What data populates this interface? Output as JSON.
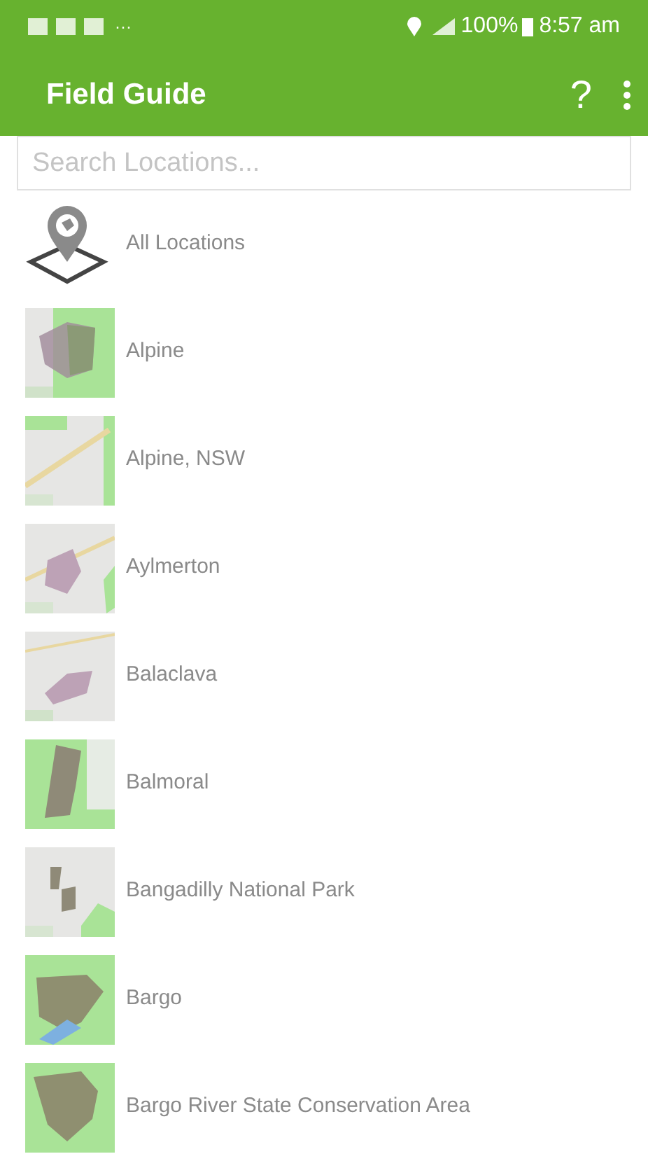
{
  "status_bar": {
    "more": "···",
    "battery": "100%",
    "time": "8:57 am"
  },
  "app_bar": {
    "title": "Field Guide",
    "help": "?"
  },
  "search": {
    "placeholder": "Search Locations..."
  },
  "locations": [
    {
      "name": "All Locations",
      "kind": "all"
    },
    {
      "name": "Alpine",
      "kind": "map"
    },
    {
      "name": "Alpine, NSW",
      "kind": "map"
    },
    {
      "name": "Aylmerton",
      "kind": "map"
    },
    {
      "name": "Balaclava",
      "kind": "map"
    },
    {
      "name": "Balmoral",
      "kind": "map"
    },
    {
      "name": "Bangadilly National Park",
      "kind": "map"
    },
    {
      "name": "Bargo",
      "kind": "map"
    },
    {
      "name": "Bargo River State Conservation Area",
      "kind": "map"
    }
  ]
}
